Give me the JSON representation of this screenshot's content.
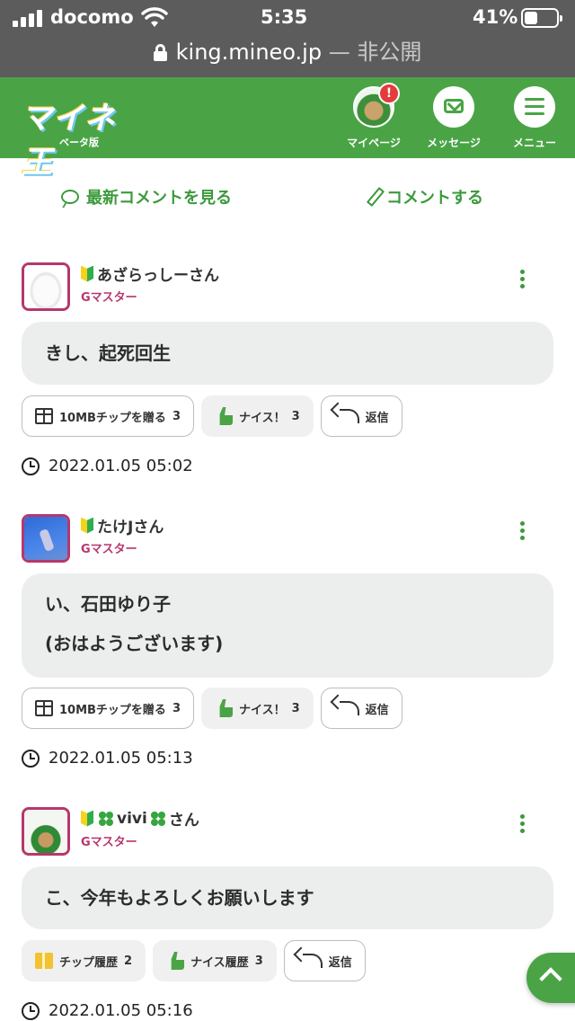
{
  "status_bar": {
    "carrier": "docomo",
    "time": "5:35",
    "battery_pct": "41%",
    "battery_level": 0.41
  },
  "url_bar": {
    "host": "king.mineo.jp",
    "suffix": "— 非公開"
  },
  "header": {
    "logo_text": "マイネ王",
    "logo_sub": "ベータ版",
    "mypage_label": "マイページ",
    "notification_badge": "!",
    "message_label": "メッセージ",
    "menu_label": "メニュー",
    "brand_color": "#4aa446"
  },
  "actions": {
    "latest_label": "最新コメントを見る",
    "comment_label": "コメントする"
  },
  "comments": [
    {
      "name": "あざらっしーさん",
      "rank": "Gマスター",
      "body": [
        "きし、起死回生"
      ],
      "tip_label": "10MBチップを贈る",
      "tip_count": "3",
      "nice_label": "ナイス！",
      "nice_count": "3",
      "reply_label": "返信",
      "time": "2022.01.05 05:02"
    },
    {
      "name": "たけJさん",
      "rank": "Gマスター",
      "body": [
        "い、石田ゆり子",
        "(おはようございます)"
      ],
      "tip_label": "10MBチップを贈る",
      "tip_count": "3",
      "nice_label": "ナイス！",
      "nice_count": "3",
      "reply_label": "返信",
      "time": "2022.01.05 05:13"
    },
    {
      "name_prefix": "vivi",
      "name_suffix": "さん",
      "rank": "Gマスター",
      "body": [
        "こ、今年もよろしくお願いします"
      ],
      "tip_label": "チップ履歴",
      "tip_count": "2",
      "nice_label": "ナイス履歴",
      "nice_count": "3",
      "reply_label": "返信",
      "time": "2022.01.05 05:16"
    }
  ]
}
